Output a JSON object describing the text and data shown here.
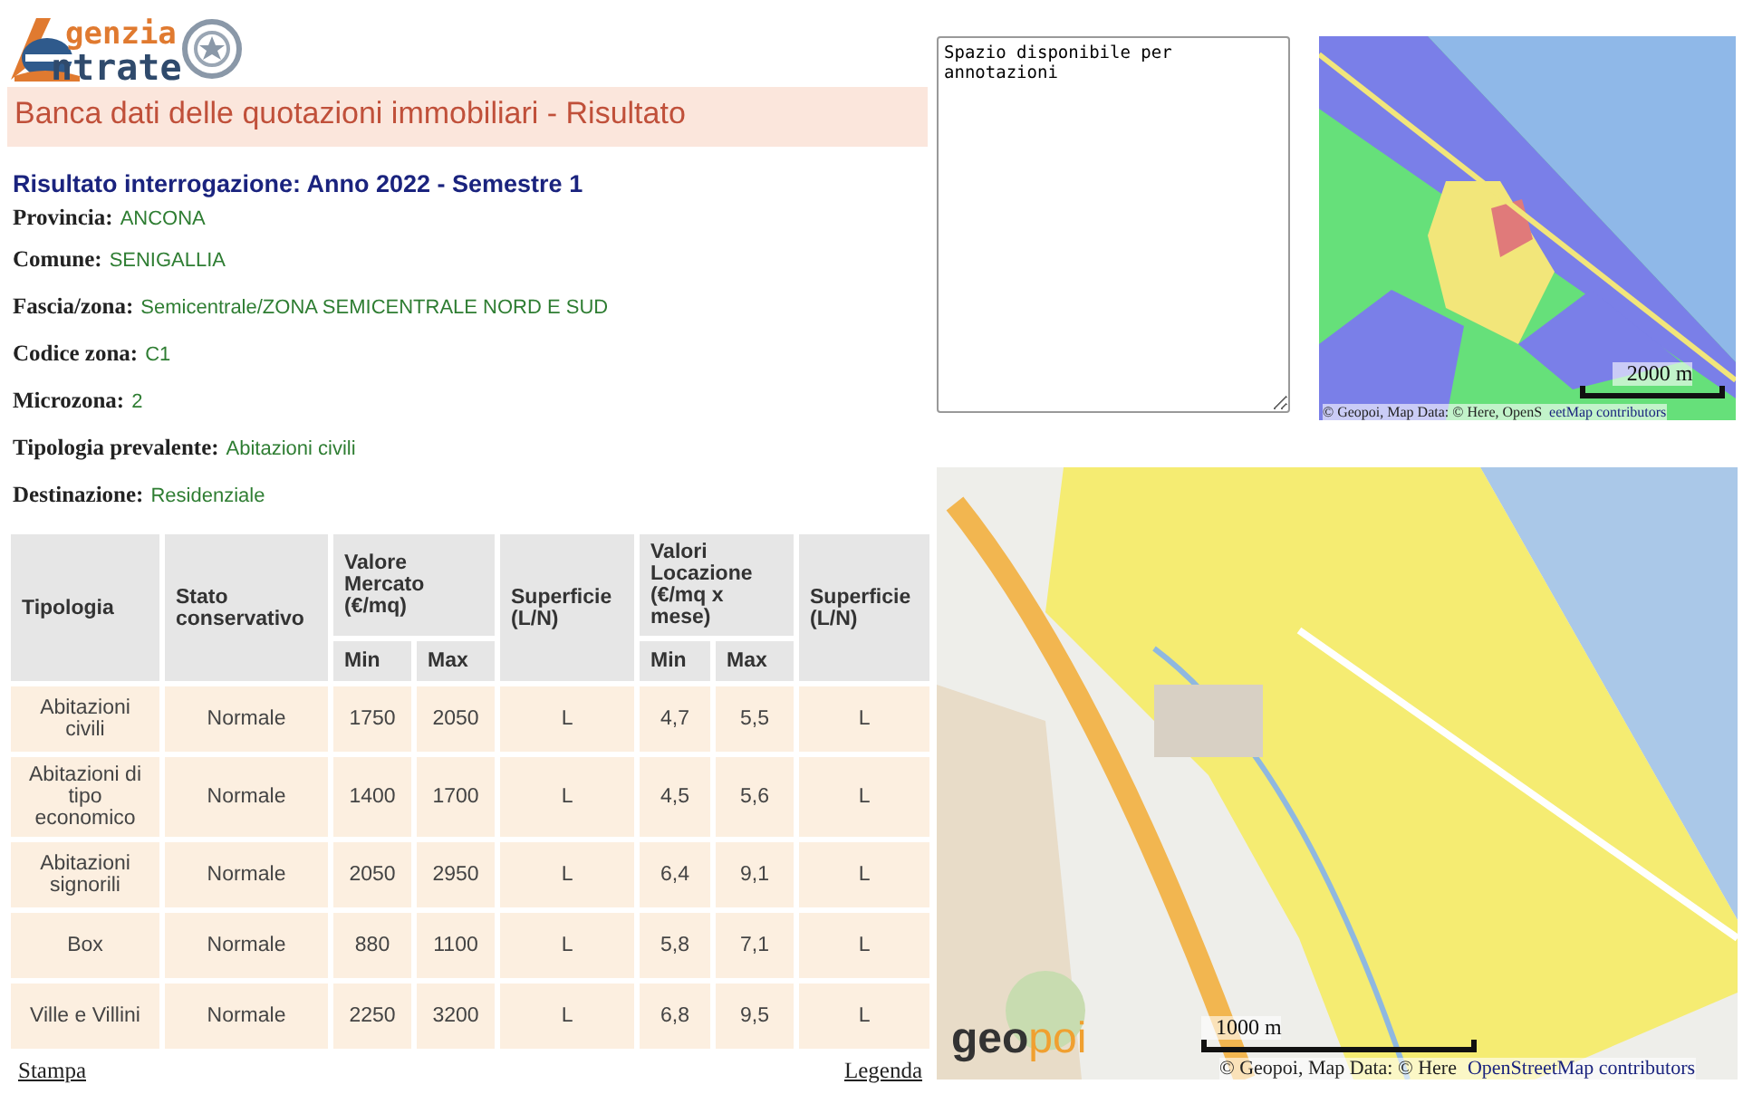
{
  "logo": {
    "line1": "genzia",
    "line2": "ntrate"
  },
  "page_title": "Banca dati delle quotazioni immobiliari - Risultato",
  "result_heading": "Risultato interrogazione: Anno 2022 - Semestre 1",
  "fields": [
    {
      "label": "Provincia:",
      "value": "ANCONA"
    },
    {
      "label": "Comune:",
      "value": "SENIGALLIA"
    },
    {
      "label": "Fascia/zona:",
      "value": "Semicentrale/ZONA SEMICENTRALE NORD E SUD"
    },
    {
      "label": "Codice zona:",
      "value": "C1"
    },
    {
      "label": "Microzona:",
      "value": "2"
    },
    {
      "label": "Tipologia prevalente:",
      "value": "Abitazioni civili"
    },
    {
      "label": "Destinazione:",
      "value": "Residenziale"
    }
  ],
  "table": {
    "header_rows": [
      [
        {
          "text": "Tipologia",
          "rowspan": 2
        },
        {
          "text": "Stato conservativo",
          "rowspan": 2
        },
        {
          "text": "Valore Mercato (€/mq)",
          "colspan": 2
        },
        {
          "text": "Superficie (L/N)",
          "rowspan": 2
        },
        {
          "text": "Valori Locazione (€/mq x mese)",
          "colspan": 2
        },
        {
          "text": "Superficie (L/N)",
          "rowspan": 2
        }
      ],
      [
        {
          "text": "Min"
        },
        {
          "text": "Max"
        },
        {
          "text": "Min"
        },
        {
          "text": "Max"
        }
      ]
    ],
    "rows": [
      [
        "Abitazioni civili",
        "Normale",
        "1750",
        "2050",
        "L",
        "4,7",
        "5,5",
        "L"
      ],
      [
        "Abitazioni di tipo economico",
        "Normale",
        "1400",
        "1700",
        "L",
        "4,5",
        "5,6",
        "L"
      ],
      [
        "Abitazioni signorili",
        "Normale",
        "2050",
        "2950",
        "L",
        "6,4",
        "9,1",
        "L"
      ],
      [
        "Box",
        "Normale",
        "880",
        "1100",
        "L",
        "5,8",
        "7,1",
        "L"
      ],
      [
        "Ville e Villini",
        "Normale",
        "2250",
        "3200",
        "L",
        "6,8",
        "9,5",
        "L"
      ]
    ]
  },
  "links": {
    "print": "Stampa",
    "legend": "Legenda"
  },
  "notes": {
    "value": "Spazio disponibile per annotazioni"
  },
  "small_map": {
    "kind": "picture",
    "scale": "2000 m",
    "attribution_left": "© Geopoi, Map Data: © Here, OpenS",
    "attribution_right": "eetMap contributors"
  },
  "large_map": {
    "kind": "picture",
    "scale": "1000 m",
    "logo_left": "geo",
    "logo_right": "poi",
    "attribution_left": "© Geopoi, Map Data: © Here",
    "attribution_right": "OpenStreetMap contributors"
  }
}
